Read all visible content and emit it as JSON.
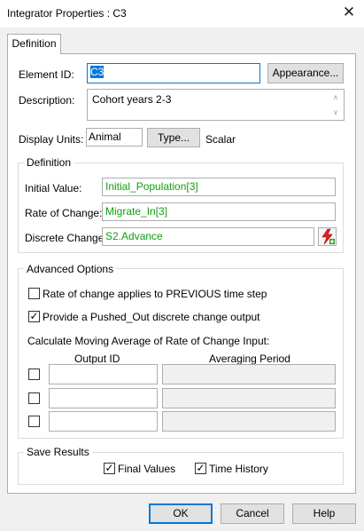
{
  "window": {
    "title": "Integrator Properties : C3",
    "close_glyph": "✕"
  },
  "tabs": [
    {
      "label": "Definition"
    }
  ],
  "element_id": {
    "label": "Element ID:",
    "value": "C3"
  },
  "appearance_button": {
    "label": "Appearance..."
  },
  "description": {
    "label": "Description:",
    "value": "Cohort years 2-3"
  },
  "display_units": {
    "label": "Display Units:",
    "value": "Animal",
    "type_button": "Type...",
    "type_value": "Scalar"
  },
  "definition_group": {
    "title": "Definition",
    "initial_value": {
      "label": "Initial Value:",
      "value": "Initial_Population[3]"
    },
    "rate_of_change": {
      "label": "Rate of Change:",
      "value": "Migrate_In[3]"
    },
    "discrete_change": {
      "label": "Discrete Change:",
      "value": "S2.Advance",
      "icon": "add-discrete-change-icon"
    }
  },
  "advanced_group": {
    "title": "Advanced Options",
    "rate_previous": {
      "label": "Rate of change applies to PREVIOUS time step",
      "checked": false
    },
    "pushed_out": {
      "label": "Provide a Pushed_Out discrete change output",
      "checked": true
    },
    "moving_average_label": "Calculate Moving Average of Rate of Change Input:",
    "columns": {
      "output_id": "Output ID",
      "averaging_period": "Averaging Period"
    },
    "rows": [
      {
        "checked": false,
        "output_id": "",
        "averaging_period": ""
      },
      {
        "checked": false,
        "output_id": "",
        "averaging_period": ""
      },
      {
        "checked": false,
        "output_id": "",
        "averaging_period": ""
      }
    ]
  },
  "save_results_group": {
    "title": "Save Results",
    "final_values": {
      "label": "Final Values",
      "checked": true
    },
    "time_history": {
      "label": "Time History",
      "checked": true
    }
  },
  "footer": {
    "ok": "OK",
    "cancel": "Cancel",
    "help": "Help"
  },
  "colors": {
    "expression_text": "#10a010",
    "selection": "#0078d7",
    "dialog_bg": "#f0f0f0"
  }
}
